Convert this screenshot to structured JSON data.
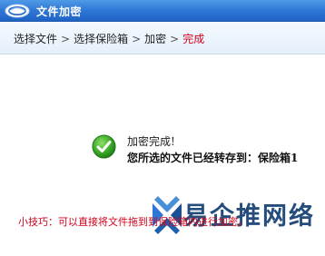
{
  "window": {
    "title": "文件加密"
  },
  "steps": {
    "step1": "选择文件",
    "step2": "选择保险箱",
    "step3": "加密",
    "step4": "完成",
    "separator": ">"
  },
  "result": {
    "title": "加密完成!",
    "detail": "您所选的文件已经转存到：保险箱1",
    "icon": "success-check-icon"
  },
  "tip": {
    "text": "小技巧：可以直接将文件拖到到保险箱内进行加密。"
  },
  "watermark": {
    "text": "易企推网络"
  },
  "colors": {
    "titlebar": "#2f77d6",
    "current_step": "#d0021b",
    "tip": "#d0021b",
    "success": "#3fae2a"
  }
}
